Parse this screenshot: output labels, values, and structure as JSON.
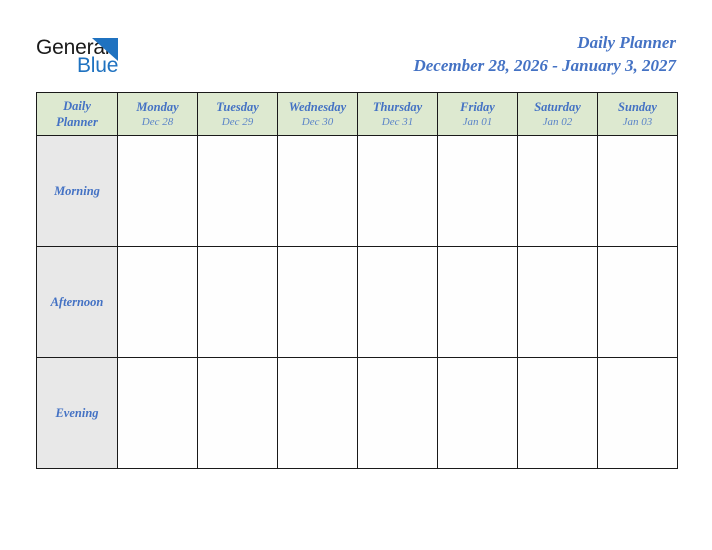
{
  "brand": {
    "name_part1": "General",
    "name_part2": "Blue",
    "triangle_color": "#1f72c0",
    "text_color": "#1a1a1a"
  },
  "header": {
    "title": "Daily Planner",
    "date_range": "December 28, 2026 - January 3, 2027",
    "title_color": "#4472c4"
  },
  "table": {
    "corner": {
      "line1": "Daily",
      "line2": "Planner"
    },
    "header_bg": "#dde9d0",
    "row_label_bg": "#e8e8e8",
    "border_color": "#1a1a1a",
    "columns": [
      {
        "day": "Monday",
        "date": "Dec 28"
      },
      {
        "day": "Tuesday",
        "date": "Dec 29"
      },
      {
        "day": "Wednesday",
        "date": "Dec 30"
      },
      {
        "day": "Thursday",
        "date": "Dec 31"
      },
      {
        "day": "Friday",
        "date": "Jan 01"
      },
      {
        "day": "Saturday",
        "date": "Jan 02"
      },
      {
        "day": "Sunday",
        "date": "Jan 03"
      }
    ],
    "rows": [
      {
        "label": "Morning",
        "cells": [
          "",
          "",
          "",
          "",
          "",
          "",
          ""
        ]
      },
      {
        "label": "Afternoon",
        "cells": [
          "",
          "",
          "",
          "",
          "",
          "",
          ""
        ]
      },
      {
        "label": "Evening",
        "cells": [
          "",
          "",
          "",
          "",
          "",
          "",
          ""
        ]
      }
    ]
  }
}
